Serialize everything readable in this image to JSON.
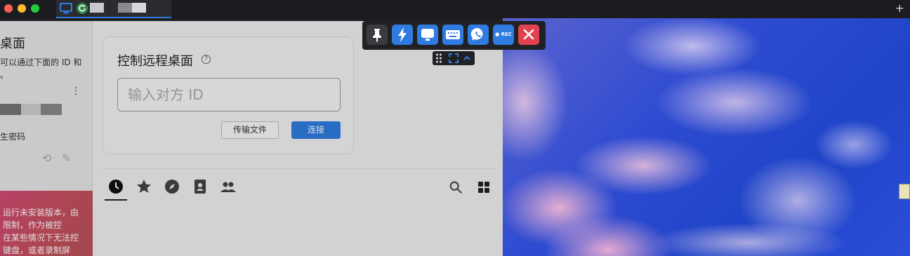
{
  "tab": {
    "icons": [
      "monitor-icon",
      "refresh-shield-icon"
    ]
  },
  "left_panel": {
    "title": "桌面",
    "description_lines": [
      "可以通过下面的 ID 和",
      "。"
    ],
    "password_label": "生密码",
    "warning_lines": [
      "运行未安装版本，由",
      "限制，作为被控",
      "在某些情况下无法控",
      "键盘，或者录制屏"
    ]
  },
  "main": {
    "control_title": "控制远程桌面",
    "id_placeholder": "输入对方 ID",
    "file_transfer_label": "传输文件",
    "connect_label": "连接"
  },
  "toolbar": {
    "buttons": [
      "pin-icon",
      "action-icon",
      "display-icon",
      "keyboard-icon",
      "chat-icon",
      "record-icon",
      "close-icon"
    ],
    "record_label": "● REC"
  },
  "colors": {
    "accent": "#2f7be0",
    "close": "#e0434f",
    "toolbar_bg": "#202124"
  }
}
